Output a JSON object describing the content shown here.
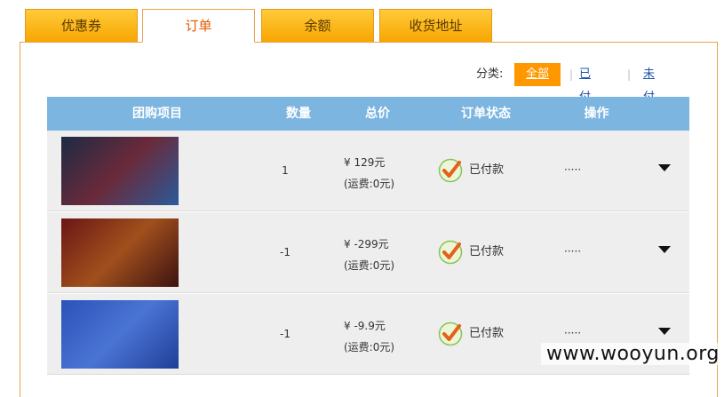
{
  "tabs": [
    {
      "label": "优惠券",
      "active": false
    },
    {
      "label": "订单",
      "active": true
    },
    {
      "label": "余额",
      "active": false
    },
    {
      "label": "收货地址",
      "active": false
    }
  ],
  "filter": {
    "label": "分类:",
    "options": [
      "全部",
      "已付款",
      "未付款"
    ],
    "selected": "全部"
  },
  "table": {
    "headers": [
      "团购项目",
      "数量",
      "总价",
      "订单状态",
      "操作"
    ],
    "rows": [
      {
        "quantity": "1",
        "price": "¥ 129元",
        "shipping": "(运费:0元)",
        "status": "已付款",
        "action": "·····",
        "thumb_colors": [
          "#1d2a44",
          "#6a2a3a",
          "#2a5a9a"
        ]
      },
      {
        "quantity": "-1",
        "price": "¥ -299元",
        "shipping": "(运费:0元)",
        "status": "已付款",
        "action": "·····",
        "thumb_colors": [
          "#6b1616",
          "#a0501c",
          "#3d1212"
        ]
      },
      {
        "quantity": "-1",
        "price": "¥ -9.9元",
        "shipping": "(运费:0元)",
        "status": "已付款",
        "action": "·····",
        "thumb_colors": [
          "#2c52b8",
          "#4a74d4",
          "#1f3f98"
        ]
      }
    ]
  },
  "icons": {
    "status": "check-icon",
    "expand": "chevron-down-icon"
  },
  "watermark": "www.wooyun.org",
  "colors": {
    "tab_orange": "#f7a500",
    "header_blue": "#7cb5e0",
    "filter_selected": "#ff9800",
    "active_tab_text": "#e35a00"
  }
}
